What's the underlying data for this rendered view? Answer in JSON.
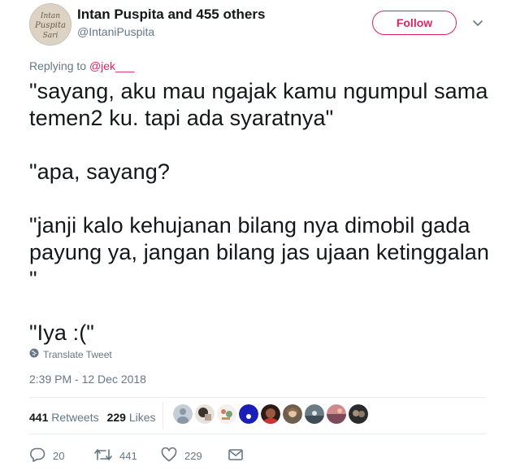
{
  "author": {
    "display_name": "Intan Puspita and 455 others",
    "handle": "@IntaniPuspita",
    "avatar_text": "Intan Puspita Sari"
  },
  "follow_button": {
    "label": "Follow"
  },
  "reply_context": {
    "prefix": "Replying to ",
    "mention": "@jek___"
  },
  "tweet": {
    "text": "\"sayang, aku mau ngajak kamu ngumpul sama temen2 ku. tapi ada syaratnya\"\n\n\"apa, sayang?\n\n\"janji kalo kehujanan bilang nya dimobil gada payung ya, jangan bilang jas ujaan ketinggalan \"\n\n\"Iya :(\""
  },
  "translate": {
    "label": "Translate Tweet"
  },
  "timestamp": "2:39 PM - 12 Dec 2018",
  "stats": {
    "retweets_count": "441",
    "retweets_label": "Retweets",
    "likes_count": "229",
    "likes_label": "Likes"
  },
  "actions": {
    "reply_count": "20",
    "retweet_count": "441",
    "like_count": "229"
  },
  "colors": {
    "accent": "#e0245e",
    "muted": "#657786",
    "text": "#14171a",
    "border": "#e6ecf0"
  }
}
